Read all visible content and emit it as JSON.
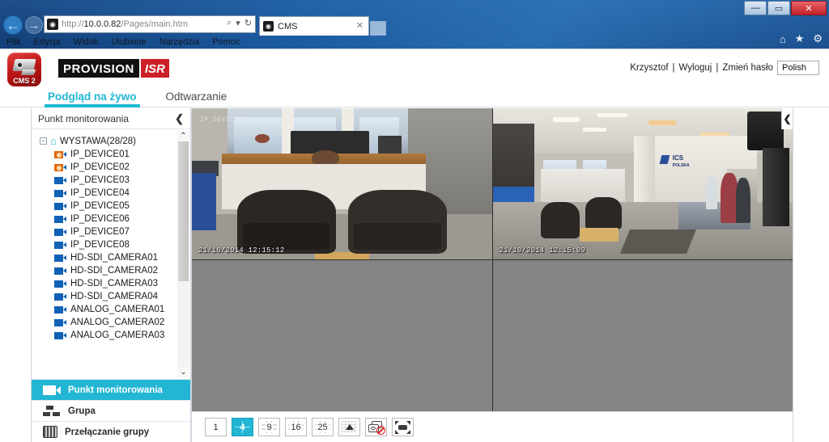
{
  "browser": {
    "window_controls": {
      "minimize": "—",
      "maximize": "▭",
      "close": "✕"
    },
    "url_prefix": "http://",
    "url_host": "10.0.0.82",
    "url_path": "/Pages/main.htm",
    "search_icon": "⌕",
    "refresh_icon": "↻",
    "dropdown_icon": "▾",
    "back_icon": "←",
    "forward_icon": "→",
    "tab": {
      "title": "CMS",
      "close": "✕",
      "favicon": "◉"
    },
    "toolbar_icons": {
      "home": "⌂",
      "favorites": "★",
      "settings": "⚙"
    },
    "menu": [
      "Plik",
      "Edycja",
      "Widok",
      "Ulubione",
      "Narzędzia",
      "Pomoc"
    ]
  },
  "app": {
    "logo": {
      "cms_label": "CMS 2",
      "brand_main": "PROVISION",
      "brand_accent": "ISR"
    },
    "user": {
      "name": "Krzysztof",
      "logout": "Wyloguj",
      "change_password": "Zmień hasło",
      "separator": "|",
      "language": "Polish"
    },
    "tabs": [
      {
        "label": "Podgląd na żywo",
        "active": true
      },
      {
        "label": "Odtwarzanie",
        "active": false
      }
    ]
  },
  "sidebar": {
    "header": {
      "title": "Punkt monitorowania",
      "collapse_icon": "❮"
    },
    "tree": {
      "root": {
        "label": "WYSTAWA(28/28)",
        "expander": "−",
        "home_icon": "⌂"
      },
      "items": [
        {
          "label": "IP_DEVICE01",
          "state": "playing"
        },
        {
          "label": "IP_DEVICE02",
          "state": "playing"
        },
        {
          "label": "IP_DEVICE03",
          "state": "idle"
        },
        {
          "label": "IP_DEVICE04",
          "state": "idle"
        },
        {
          "label": "IP_DEVICE05",
          "state": "idle"
        },
        {
          "label": "IP_DEVICE06",
          "state": "idle"
        },
        {
          "label": "IP_DEVICE07",
          "state": "idle"
        },
        {
          "label": "IP_DEVICE08",
          "state": "idle"
        },
        {
          "label": "HD-SDI_CAMERA01",
          "state": "idle"
        },
        {
          "label": "HD-SDI_CAMERA02",
          "state": "idle"
        },
        {
          "label": "HD-SDI_CAMERA03",
          "state": "idle"
        },
        {
          "label": "HD-SDI_CAMERA04",
          "state": "idle"
        },
        {
          "label": "ANALOG_CAMERA01",
          "state": "idle"
        },
        {
          "label": "ANALOG_CAMERA02",
          "state": "idle"
        },
        {
          "label": "ANALOG_CAMERA03",
          "state": "idle"
        }
      ],
      "scroll_up": "⌃",
      "scroll_down": "⌄"
    },
    "nav": [
      {
        "label": "Punkt monitorowania",
        "active": true
      },
      {
        "label": "Grupa",
        "active": false
      },
      {
        "label": "Przełączanie grupy",
        "active": false
      }
    ]
  },
  "video": {
    "collapse_icon": "❮",
    "cells": [
      {
        "index": 1,
        "active": true,
        "timestamp": "21/10/2014 12:15:12",
        "camlabel": "IP_DEVICE01",
        "empty": false
      },
      {
        "index": 2,
        "active": false,
        "timestamp": "21/10/2014 12:15:09",
        "camlabel": "IP_DEVICE02",
        "empty": false
      },
      {
        "index": 3,
        "active": false,
        "timestamp": "",
        "camlabel": "",
        "empty": true
      },
      {
        "index": 4,
        "active": false,
        "timestamp": "",
        "camlabel": "",
        "empty": true
      }
    ]
  },
  "toolbar": {
    "layouts": [
      {
        "label": "1",
        "selected": false
      },
      {
        "label": "4",
        "selected": true
      },
      {
        "label": "9",
        "selected": false
      },
      {
        "label": "16",
        "selected": false
      },
      {
        "label": "25",
        "selected": false
      }
    ],
    "more_layout_label": "",
    "snapshot_label": "",
    "fullscreen_label": ""
  },
  "colors": {
    "accent": "#22b6d4",
    "brand_red": "#cc1f27",
    "tree_icon_blue": "#1161b7",
    "tree_icon_active": "#e06a10",
    "empty_cell": "#848484"
  }
}
